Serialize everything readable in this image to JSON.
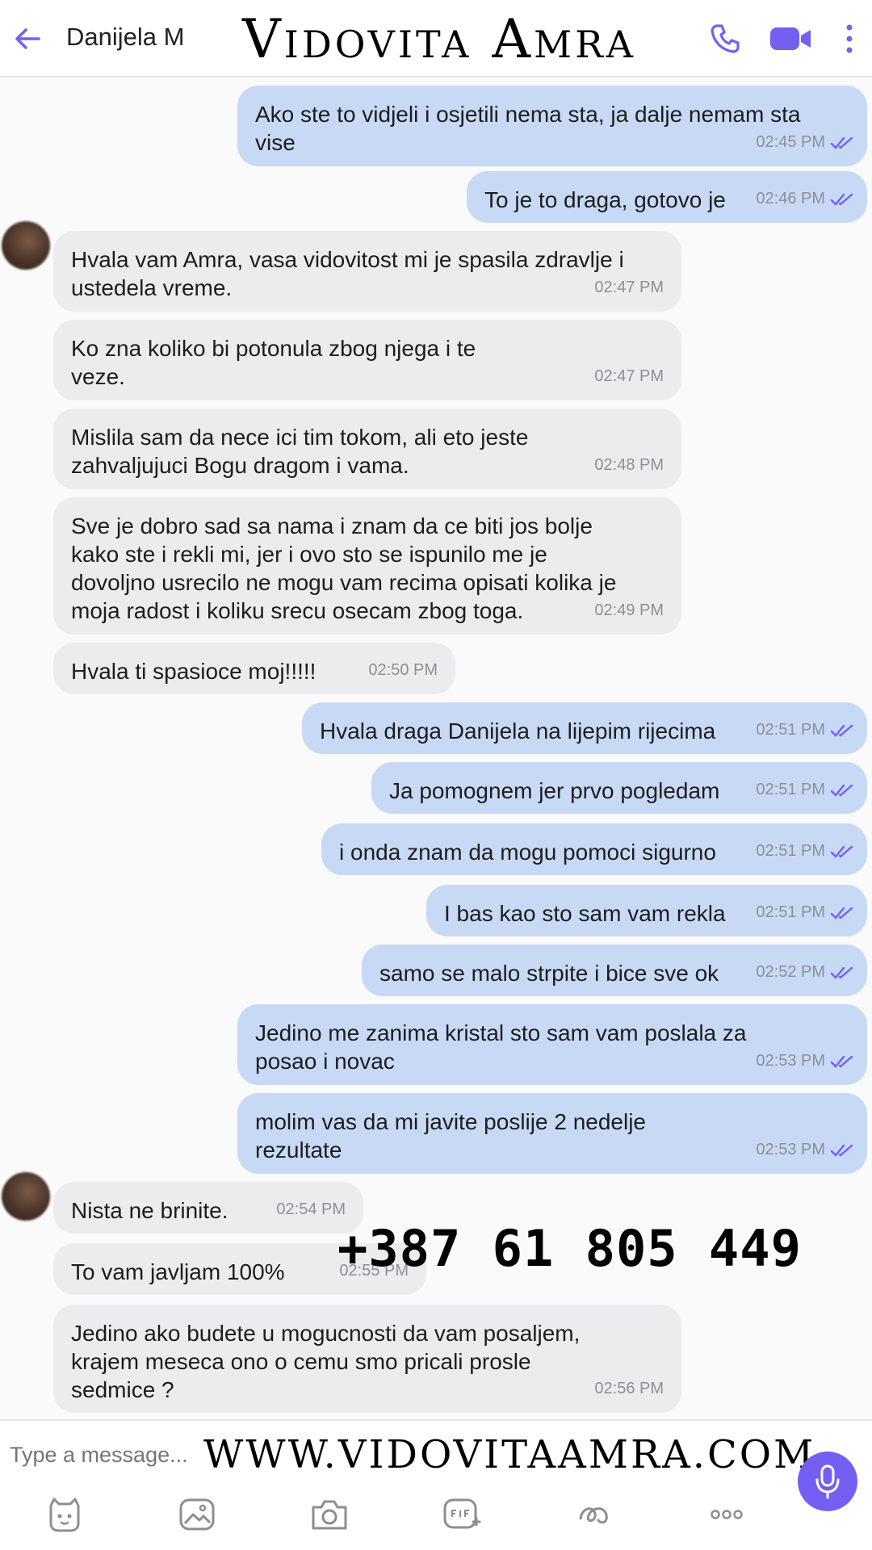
{
  "header": {
    "contact_name": "Danijela M",
    "brand_title": "Vidovita Amra",
    "icons": [
      "back-arrow-icon",
      "phone-icon",
      "video-call-icon",
      "more-vertical-icon"
    ]
  },
  "messages": [
    {
      "dir": "out",
      "text": "Ako ste to vidjeli i osjetili nema sta, ja dalje nemam sta\nvise",
      "time": "02:45 PM"
    },
    {
      "dir": "out",
      "text": "To je to draga, gotovo je",
      "time": "02:46 PM"
    },
    {
      "dir": "in",
      "text": "Hvala vam Amra, vasa vidovitost mi je spasila zdravlje i\nustedela vreme.",
      "time": "02:47 PM"
    },
    {
      "dir": "in",
      "text": "Ko zna koliko bi potonula zbog njega i te\nveze.",
      "time": "02:47 PM"
    },
    {
      "dir": "in",
      "text": "Mislila sam da nece ici tim tokom, ali eto jeste\nzahvaljujuci Bogu dragom i vama.",
      "time": "02:48 PM"
    },
    {
      "dir": "in",
      "text": "Sve je dobro sad sa nama i znam da ce biti jos bolje\nkako ste i rekli mi, jer i ovo sto se ispunilo me je\ndovoljno usrecilo ne mogu vam recima opisati kolika je\nmoja radost i koliku srecu osecam zbog toga.",
      "time": "02:49 PM"
    },
    {
      "dir": "in",
      "text": "Hvala ti spasioce moj!!!!!",
      "time": "02:50 PM"
    },
    {
      "dir": "out",
      "text": "Hvala draga Danijela na lijepim rijecima",
      "time": "02:51 PM"
    },
    {
      "dir": "out",
      "text": "Ja pomognem jer prvo pogledam",
      "time": "02:51 PM"
    },
    {
      "dir": "out",
      "text": "i onda znam da mogu pomoci sigurno",
      "time": "02:51 PM"
    },
    {
      "dir": "out",
      "text": "I bas kao sto sam vam rekla",
      "time": "02:51 PM"
    },
    {
      "dir": "out",
      "text": "samo se malo strpite i bice sve ok",
      "time": "02:52 PM"
    },
    {
      "dir": "out",
      "text": "Jedino me zanima kristal sto sam vam poslala za\nposao i novac",
      "time": "02:53 PM"
    },
    {
      "dir": "out",
      "text": "molim vas da mi javite poslije 2 nedelje\nrezultate",
      "time": "02:53 PM"
    },
    {
      "dir": "in",
      "text": "Nista ne brinite.",
      "time": "02:54 PM"
    },
    {
      "dir": "in",
      "text": "To vam javljam 100%",
      "time": "02:55 PM"
    },
    {
      "dir": "in",
      "text": "Jedino ako budete u mogucnosti da vam posaljem,\nkrajem meseca ono o cemu smo pricali prosle\nsedmice ?",
      "time": "02:56 PM"
    }
  ],
  "overlay": {
    "phone": "+387 61 805 449",
    "website": "WWW.VIDOVITAAMRA.COM"
  },
  "composer": {
    "placeholder": "Type a message...",
    "tool_icons": [
      "sticker-icon",
      "gallery-icon",
      "camera-icon",
      "gif-icon",
      "doodle-icon",
      "more-horizontal-icon"
    ],
    "mic_icon": "microphone-icon"
  },
  "colors": {
    "accent": "#7360f2",
    "outgoing_bubble": "#c7d9f5",
    "incoming_bubble": "#ececef",
    "read_ticks": "#7360f2"
  }
}
